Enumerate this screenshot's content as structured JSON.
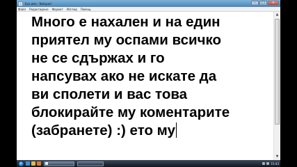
{
  "window": {
    "title": "Без име - Notepad",
    "controls": {
      "minimize": "–",
      "maximize": "□",
      "close": "×"
    }
  },
  "menu": {
    "items": [
      "Файл",
      "Редактиране",
      "Формат",
      "Изглед",
      "Помощ"
    ]
  },
  "editor": {
    "lines": [
      "Много е нахален и на един",
      "приятел му оспами всичко",
      "не се сдържах и го",
      "напсувах ако не искате да",
      "ви сполети и вас това",
      "блокирайте му коментарите",
      "(забранете) :) ето му"
    ]
  },
  "taskbar": {
    "icons": [
      "start-orb-icon",
      "internet-explorer-icon",
      "folder-icon",
      "media-player-icon"
    ],
    "clock": "15:43"
  },
  "colors": {
    "background": "#000000",
    "window": "#ffffff",
    "titlebar": "#4a86b8",
    "taskbar": "#11171f"
  }
}
